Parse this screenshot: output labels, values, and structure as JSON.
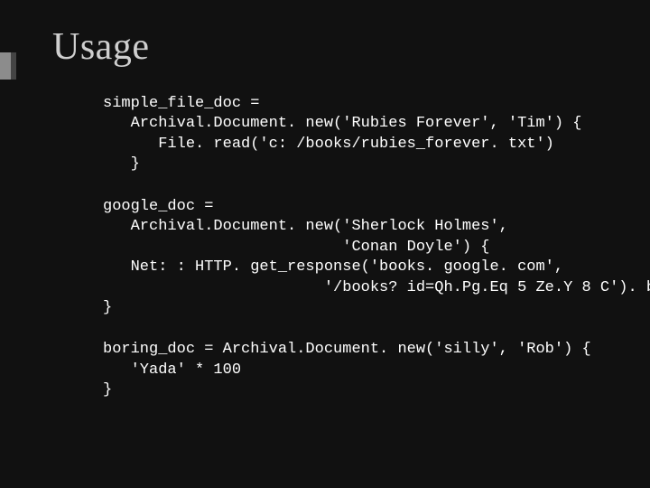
{
  "title": "Usage",
  "code": {
    "block1": "simple_file_doc =\n   Archival.Document. new('Rubies Forever', 'Tim') {\n      File. read('c: /books/rubies_forever. txt')\n   }",
    "block2": "google_doc =\n   Archival.Document. new('Sherlock Holmes',\n                          'Conan Doyle') {\n   Net: : HTTP. get_response('books. google. com',\n                        '/books? id=Qh.Pg.Eq 5 Ze.Y 8 C'). body\n}",
    "block3": "boring_doc = Archival.Document. new('silly', 'Rob') {\n   'Yada' * 100\n}"
  }
}
